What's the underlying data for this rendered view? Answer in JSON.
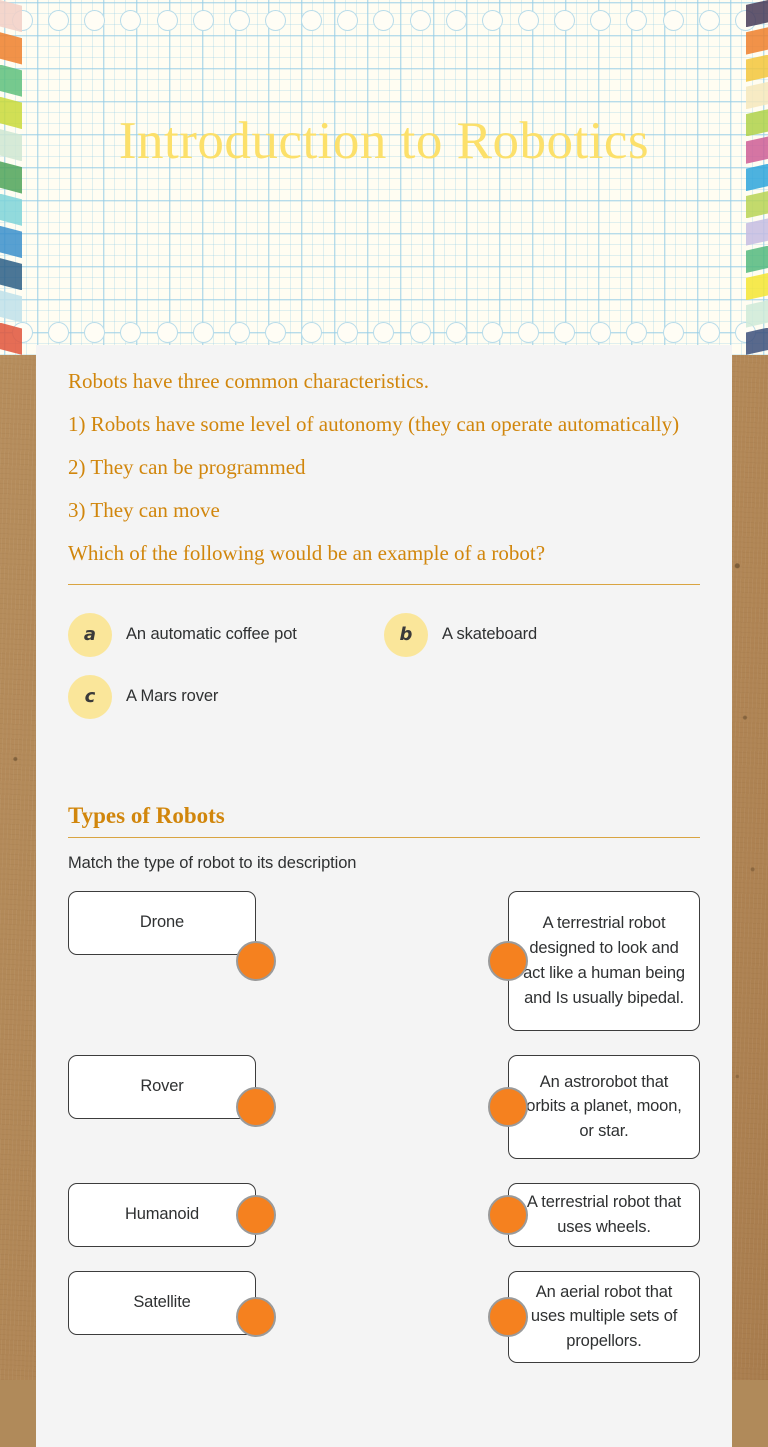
{
  "banner": {
    "title": "Introduction to Robotics",
    "title_color": "#FCE06A",
    "paper_style": "graph-paper",
    "edge_colors_left": [
      "#F2CFC6",
      "#EE7F2C",
      "#5EBF7C",
      "#C9D93A",
      "#CFE6D2",
      "#4FA359",
      "#7FD4D8",
      "#3B8FCB",
      "#2B5E86",
      "#BFE0EA",
      "#E0533A"
    ],
    "edge_colors_right": [
      "#463A57",
      "#EE7F2C",
      "#F3C63B",
      "#F6E7BC",
      "#AFD149",
      "#CE5D95",
      "#2EA5DC",
      "#B9D455",
      "#C6BCE2",
      "#54B97E",
      "#F5E532",
      "#CFEAD8",
      "#3C4F7A"
    ]
  },
  "prompt": {
    "intro": "Robots have three common characteristics.",
    "point1": "1) Robots have some level of autonomy (they can operate automatically)",
    "point2": "2) They can be programmed",
    "point3": "3) They can move",
    "question": "Which of the following would be an example of a robot?",
    "text_color": "#d1860c"
  },
  "options": [
    {
      "letter": "a",
      "text": "An automatic coffee pot"
    },
    {
      "letter": "b",
      "text": "A skateboard"
    },
    {
      "letter": "c",
      "text": "A Mars rover"
    }
  ],
  "section": {
    "title": "Types of Robots",
    "instruction": "Match the type of robot to its description"
  },
  "matching": {
    "dot_color": "#F5811F",
    "pairs": [
      {
        "term": "Drone",
        "description": "A terrestrial robot designed to look and act like a human being and Is usually bipedal."
      },
      {
        "term": "Rover",
        "description": "An astrorobot that orbits a planet, moon, or star."
      },
      {
        "term": "Humanoid",
        "description": "A terrestrial robot that uses wheels."
      },
      {
        "term": "Satellite",
        "description": "An aerial robot that uses multiple sets of propellors."
      }
    ]
  }
}
